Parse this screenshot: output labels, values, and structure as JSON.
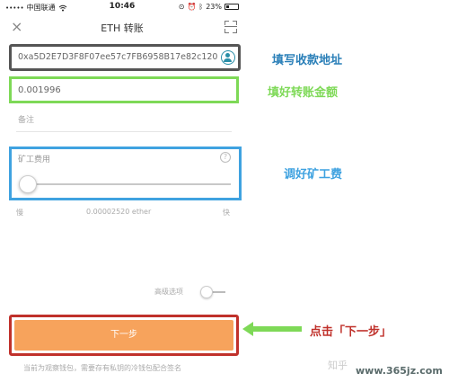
{
  "statusbar": {
    "carrier": "中国联通",
    "signal_dots": "•••••",
    "wifi_icon": "wifi-icon",
    "time": "10:46",
    "battery": "23%"
  },
  "navbar": {
    "title": "ETH 转账",
    "close_icon": "×"
  },
  "form": {
    "address_value": "0xa5D2E7D3F8F07ee57c7FB6958B17e82c120...",
    "amount_value": "0.001996",
    "memo_placeholder": "备注",
    "fee_label": "矿工费用",
    "fee_help": "?",
    "fee_slow": "慢",
    "fee_value": "0.00002520 ether",
    "fee_fast": "快",
    "advanced_label": "高级选项",
    "next_button": "下一步",
    "footer_note": "当前为观察钱包，需要存有私钥的冷钱包配合签名"
  },
  "annotations": {
    "address": "填写收款地址",
    "amount": "填好转账金额",
    "fee": "调好矿工费",
    "next": "点击「下一步」"
  },
  "watermark": {
    "zhihu": "知乎",
    "url": "www.365jz.com"
  },
  "colors": {
    "address_border": "#555555",
    "amount_border": "#7ed957",
    "fee_border": "#3fa2e0",
    "next_border": "#c0312b",
    "button_fill": "#f7a35c",
    "annotation_blue": "#2a7fb8"
  },
  "slider": {
    "fee_level_fraction": 0.02
  }
}
